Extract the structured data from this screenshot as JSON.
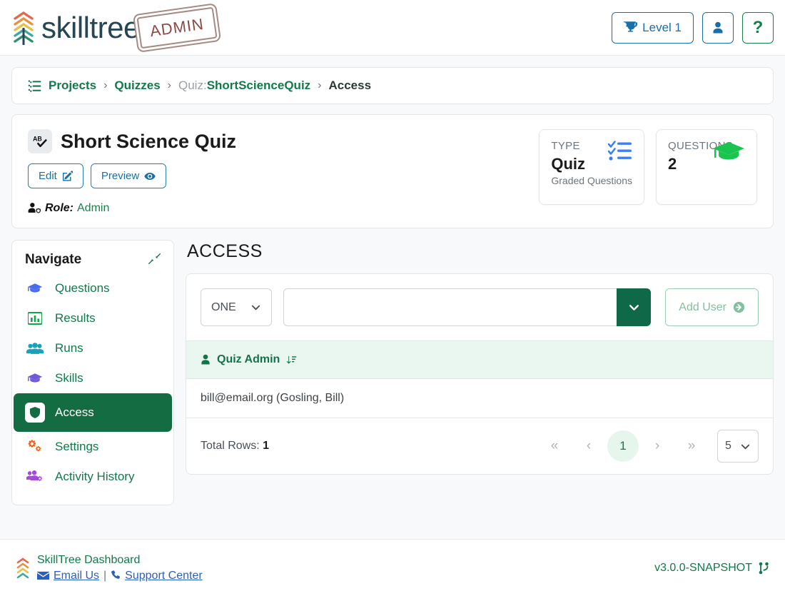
{
  "header": {
    "logo_word": "skilltree",
    "admin_stamp": "ADMIN",
    "level_label": "Level 1",
    "level_icon": "trophy-icon",
    "user_icon": "user-icon",
    "help_icon": "question-mark-icon"
  },
  "breadcrumb": {
    "icon": "list-tree-icon",
    "items": [
      {
        "label": "Projects",
        "type": "link"
      },
      {
        "label": "Quizzes",
        "type": "link"
      },
      {
        "prefix": "Quiz:",
        "label": "ShortScienceQuiz",
        "type": "link"
      },
      {
        "label": "Access",
        "type": "current"
      }
    ],
    "separator": "›"
  },
  "title_card": {
    "badge_icon": "spell-check-icon",
    "title": "Short Science Quiz",
    "edit_label": "Edit",
    "edit_icon": "pencil-square-icon",
    "preview_label": "Preview",
    "preview_icon": "eye-icon",
    "role_icon": "user-shield-icon",
    "role_label": "Role:",
    "role_value": "Admin"
  },
  "stats": [
    {
      "label": "TYPE",
      "value": "Quiz",
      "sub": "Graded Questions",
      "icon": "checklist-icon",
      "icon_color": "#3d7ff2"
    },
    {
      "label": "QUESTIONS",
      "value": "2",
      "sub": "",
      "icon": "graduation-cap-icon",
      "icon_color": "#19c44f"
    }
  ],
  "navigate": {
    "title": "Navigate",
    "collapse_icon": "compress-arrows-icon",
    "items": [
      {
        "label": "Questions",
        "icon": "graduation-cap-icon",
        "icon_color": "#4a6cf0",
        "active": false
      },
      {
        "label": "Results",
        "icon": "bar-chart-icon",
        "icon_color": "#17a34a",
        "active": false
      },
      {
        "label": "Runs",
        "icon": "users-icon",
        "icon_color": "#1aa3b8",
        "active": false
      },
      {
        "label": "Skills",
        "icon": "graduation-cap-icon",
        "icon_color": "#6f5bd6",
        "active": false
      },
      {
        "label": "Access",
        "icon": "shield-icon",
        "icon_color": "#146c43",
        "active": true
      },
      {
        "label": "Settings",
        "icon": "gears-icon",
        "icon_color": "#f0601a",
        "active": false
      },
      {
        "label": "Activity History",
        "icon": "users-cog-icon",
        "icon_color": "#a64bd6",
        "active": false
      }
    ]
  },
  "access": {
    "section_title": "ACCESS",
    "role_select": {
      "value": "ONE",
      "chevron_icon": "chevron-down-icon"
    },
    "user_input": {
      "value": "",
      "placeholder": ""
    },
    "user_dropdown_icon": "chevron-down-icon",
    "add_user": {
      "label": "Add User",
      "icon": "arrow-circle-right-icon",
      "disabled": true
    },
    "table": {
      "column_icon": "user-icon",
      "column_header": "Quiz Admin",
      "sort_icon": "sort-down-icon",
      "rows": [
        {
          "user": "bill@email.org (Gosling, Bill)"
        }
      ]
    },
    "pagination": {
      "total_rows_label": "Total Rows:",
      "total_rows_value": "1",
      "first_icon": "«",
      "prev_icon": "‹",
      "current_page": "1",
      "next_icon": "›",
      "last_icon": "»",
      "page_size": "5",
      "page_size_chevron": "chevron-down-icon"
    }
  },
  "footer": {
    "logo_icon": "skilltree-chevrons-icon",
    "dashboard_label": "SkillTree Dashboard",
    "email_icon": "envelope-icon",
    "email_label": "Email Us",
    "divider": "|",
    "phone_icon": "phone-icon",
    "support_label": "Support Center",
    "version": "v3.0.0-SNAPSHOT",
    "version_icon": "code-branch-icon"
  },
  "colors": {
    "brand_green": "#146c43",
    "link_green": "#14794a",
    "link_blue": "#2b5fbe",
    "accent_blue": "#1a6fa8",
    "table_head_bg": "#eaf7f0"
  }
}
